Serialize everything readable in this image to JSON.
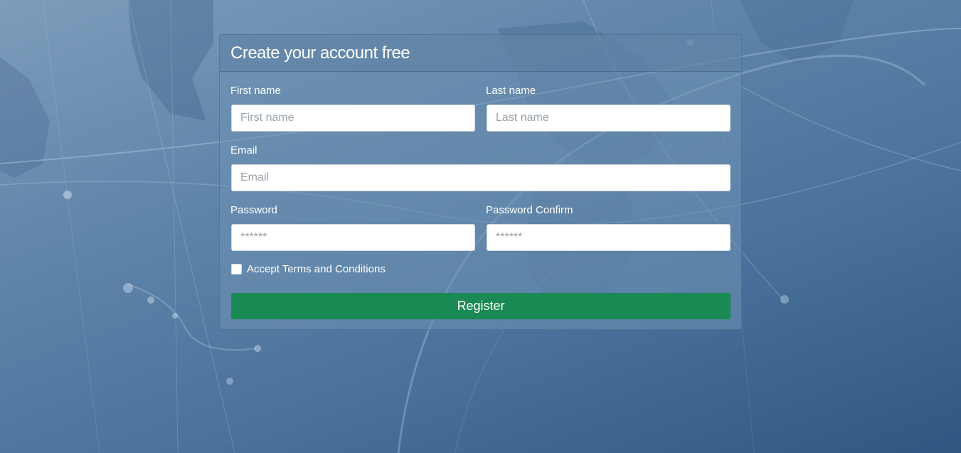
{
  "form": {
    "title": "Create your account free",
    "first_name": {
      "label": "First name",
      "placeholder": "First name",
      "value": ""
    },
    "last_name": {
      "label": "Last name",
      "placeholder": "Last name",
      "value": ""
    },
    "email": {
      "label": "Email",
      "placeholder": "Email",
      "value": ""
    },
    "password": {
      "label": "Password",
      "placeholder": "******",
      "value": ""
    },
    "password_confirm": {
      "label": "Password Confirm",
      "placeholder": "******",
      "value": ""
    },
    "terms": {
      "label": "Accept Terms and Conditions",
      "checked": false
    },
    "register_label": "Register"
  },
  "colors": {
    "register_button": "#1a8a55",
    "background_top": "#7d9dbb",
    "background_bottom": "#2f5782"
  }
}
